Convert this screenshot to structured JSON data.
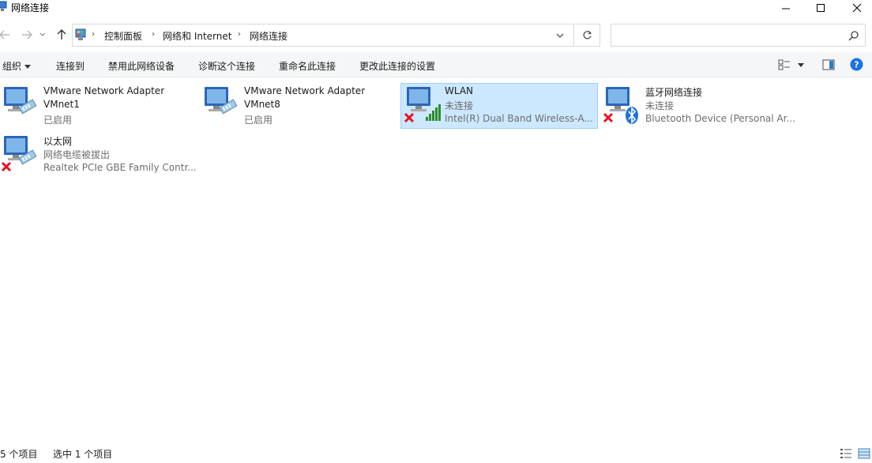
{
  "window": {
    "title": "网络连接"
  },
  "address": {
    "crumbs": [
      "控制面板",
      "网络和 Internet",
      "网络连接"
    ]
  },
  "search": {
    "placeholder": ""
  },
  "commands": {
    "organize": "组织",
    "connect_to": "连接到",
    "disable": "禁用此网络设备",
    "diagnose": "诊断这个连接",
    "rename": "重命名此连接",
    "change_settings": "更改此连接的设置"
  },
  "connections": [
    {
      "name": "VMware Network Adapter VMnet1",
      "line1": "VMware Network Adapter",
      "line2": "VMnet1",
      "line3": "已启用",
      "status_icon": "wired-network-icon",
      "selected": false
    },
    {
      "name": "VMware Network Adapter VMnet8",
      "line1": "VMware Network Adapter",
      "line2": "VMnet8",
      "line3": "已启用",
      "status_icon": "wired-network-icon",
      "selected": false
    },
    {
      "name": "WLAN",
      "line1": "WLAN",
      "line2": "未连接",
      "line3": "Intel(R) Dual Band Wireless-A...",
      "status_icon": "wifi-signal-icon",
      "selected": true
    },
    {
      "name": "蓝牙网络连接",
      "line1": "蓝牙网络连接",
      "line2": "未连接",
      "line3": "Bluetooth Device (Personal Ar...",
      "status_icon": "bluetooth-icon",
      "selected": false
    },
    {
      "name": "以太网",
      "line1": "以太网",
      "line2": "网络电缆被拔出",
      "line3": "Realtek PCIe GBE Family Contr...",
      "status_icon": "wired-network-icon",
      "selected": false
    }
  ],
  "status": {
    "count": "5 个项目",
    "selected": "选中 1 个项目"
  },
  "colors": {
    "selection_bg": "#cce8ff",
    "selection_border": "#99d1ff",
    "help_blue": "#1a73e8",
    "error_red": "#e81123"
  }
}
